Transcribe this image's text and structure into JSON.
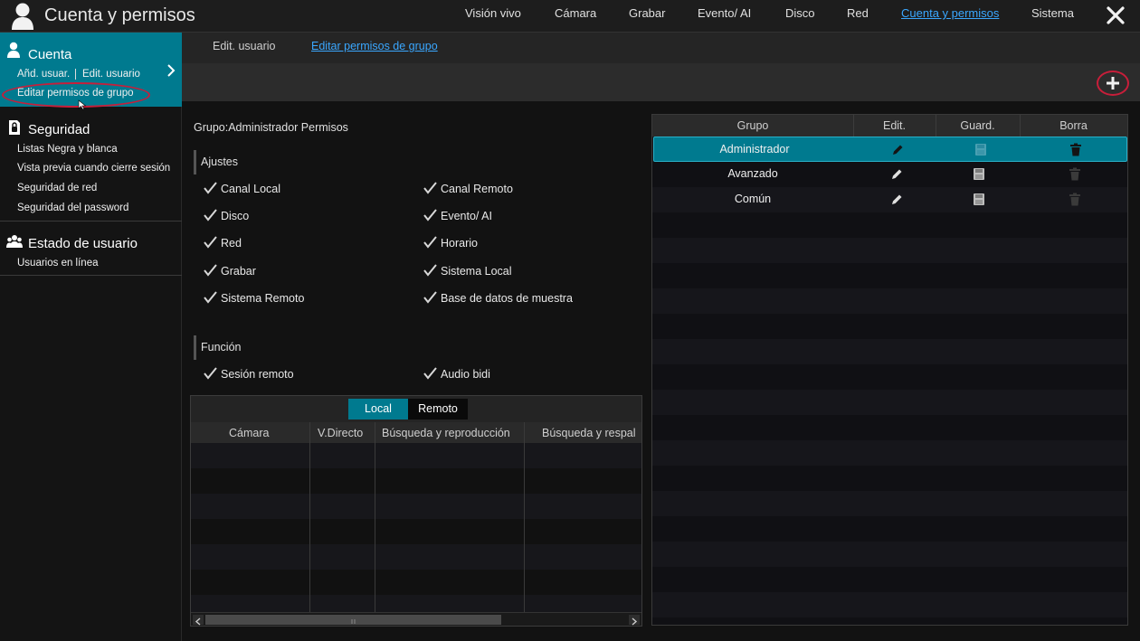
{
  "app_title": "Cuenta y permisos",
  "nav": [
    {
      "label": "Visión vivo",
      "active": false
    },
    {
      "label": "Cámara",
      "active": false
    },
    {
      "label": "Grabar",
      "active": false
    },
    {
      "label": "Evento/ AI",
      "active": false
    },
    {
      "label": "Disco",
      "active": false
    },
    {
      "label": "Red",
      "active": false
    },
    {
      "label": "Cuenta y permisos",
      "active": true
    },
    {
      "label": "Sistema",
      "active": false
    }
  ],
  "sidebar": {
    "cuenta": {
      "title": "Cuenta",
      "items": [
        "Añd. usuar.",
        "Edit. usuario",
        "Editar permisos de grupo"
      ]
    },
    "seguridad": {
      "title": "Seguridad",
      "items": [
        "Listas Negra y blanca",
        "Vista previa cuando cierre sesión",
        "Seguridad de red",
        "Seguridad del password"
      ]
    },
    "estado": {
      "title": "Estado de usuario",
      "items": [
        "Usuarios en línea"
      ]
    }
  },
  "subtabs": [
    {
      "label": "Edit. usuario",
      "active": false
    },
    {
      "label": "Editar permisos de grupo",
      "active": true
    }
  ],
  "permissions": {
    "title": "Grupo:Administrador Permisos",
    "ajustes_label": "Ajustes",
    "ajustes": [
      "Canal Local",
      "Canal Remoto",
      "Disco",
      "Evento/ AI",
      "Red",
      "Horario",
      "Grabar",
      "Sistema Local",
      "Sistema Remoto",
      "Base de datos de muestra"
    ],
    "funcion_label": "Función",
    "funcion": [
      "Sesión remoto",
      "Audio bidi"
    ]
  },
  "channel_table": {
    "segments": [
      {
        "label": "Local",
        "active": true
      },
      {
        "label": "Remoto",
        "active": false
      }
    ],
    "headers": [
      "Cámara",
      "V.Directo",
      "Búsqueda y reproducción",
      "Búsqueda y respal"
    ]
  },
  "group_table": {
    "headers": [
      "Grupo",
      "Edit.",
      "Guard.",
      "Borra"
    ],
    "rows": [
      {
        "name": "Administrador",
        "selected": true
      },
      {
        "name": "Avanzado",
        "selected": false
      },
      {
        "name": "Común",
        "selected": false
      }
    ]
  },
  "colors": {
    "accent": "#007a8f",
    "link": "#3aa7ff",
    "annotation": "#c81e3a"
  }
}
